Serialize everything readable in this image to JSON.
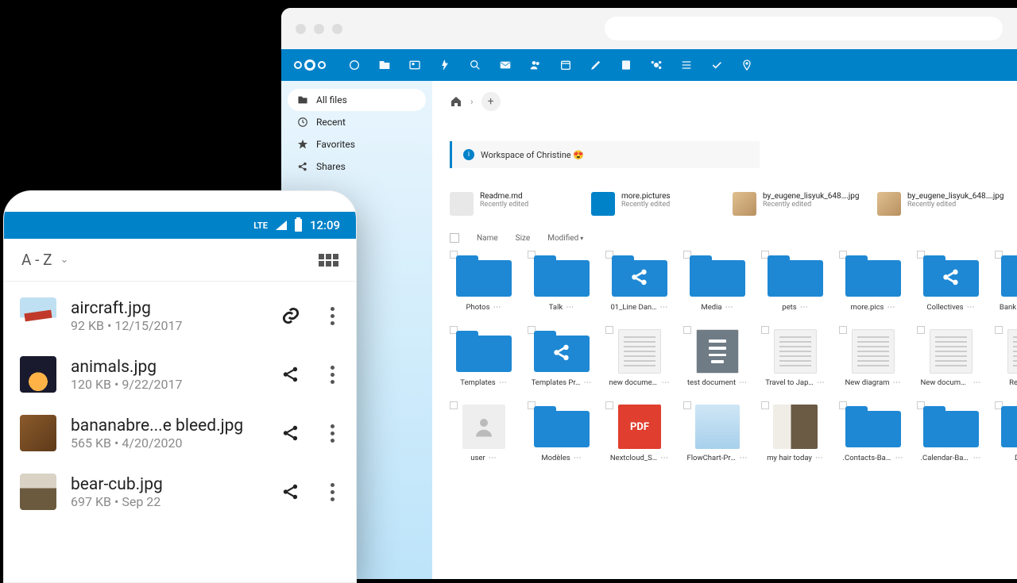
{
  "mobile": {
    "status": {
      "network": "LTE",
      "time": "12:09"
    },
    "sort": {
      "label": "A - Z"
    },
    "files": [
      {
        "name": "aircraft.jpg",
        "size": "92 KB",
        "date": "12/15/2017",
        "action": "link"
      },
      {
        "name": "animals.jpg",
        "size": "120 KB",
        "date": "9/22/2017",
        "action": "share"
      },
      {
        "name": "bananabre...e bleed.jpg",
        "size": "565 KB",
        "date": "4/20/2020",
        "action": "share"
      },
      {
        "name": "bear-cub.jpg",
        "size": "697 KB",
        "date": "Sep 22",
        "action": "share"
      }
    ]
  },
  "desktop": {
    "sidebar": [
      {
        "icon": "folder",
        "label": "All files",
        "active": true
      },
      {
        "icon": "clock",
        "label": "Recent"
      },
      {
        "icon": "star",
        "label": "Favorites"
      },
      {
        "icon": "share",
        "label": "Shares"
      }
    ],
    "workspace_banner": "Workspace of Christine 😍",
    "recent": [
      {
        "name": "Readme.md",
        "sub": "Recently edited",
        "kind": "readme"
      },
      {
        "name": "more.pictures",
        "sub": "Recently edited",
        "kind": "folder"
      },
      {
        "name": "by_eugene_lisyuk_648….jpg",
        "sub": "Recently edited",
        "kind": "img"
      },
      {
        "name": "by_eugene_lisyuk_648….jpg",
        "sub": "Recently edited",
        "kind": "img"
      }
    ],
    "columns": {
      "name": "Name",
      "size": "Size",
      "modified": "Modified"
    },
    "tiles": [
      {
        "label": "Photos",
        "kind": "folder"
      },
      {
        "label": "Talk",
        "kind": "folder"
      },
      {
        "label": "01_Line Dan…",
        "kind": "folder-share"
      },
      {
        "label": "Media",
        "kind": "folder"
      },
      {
        "label": "pets",
        "kind": "folder"
      },
      {
        "label": "more.pics",
        "kind": "folder"
      },
      {
        "label": "Collectives",
        "kind": "folder-share"
      },
      {
        "label": "Bank docum…",
        "kind": "folder-link"
      },
      {
        "label": "Templates",
        "kind": "folder"
      },
      {
        "label": "Templates Pr…",
        "kind": "folder-share"
      },
      {
        "label": "new document",
        "kind": "doc"
      },
      {
        "label": "test document",
        "kind": "textdoc"
      },
      {
        "label": "Travel to Jap…",
        "kind": "doc"
      },
      {
        "label": "New diagram",
        "kind": "doc"
      },
      {
        "label": "New docume…",
        "kind": "doc"
      },
      {
        "label": "Readme",
        "kind": "doc"
      },
      {
        "label": "user",
        "kind": "user"
      },
      {
        "label": "Modèles",
        "kind": "folder"
      },
      {
        "label": "Nextcloud_S…",
        "kind": "pdf"
      },
      {
        "label": "FlowChart-Pro…",
        "kind": "img-flow"
      },
      {
        "label": "my hair today",
        "kind": "img-hair"
      },
      {
        "label": ".Contacts-Backup",
        "kind": "folder"
      },
      {
        "label": ".Calendar-Backup",
        "kind": "folder"
      },
      {
        "label": "Deck",
        "kind": "folder"
      }
    ]
  }
}
